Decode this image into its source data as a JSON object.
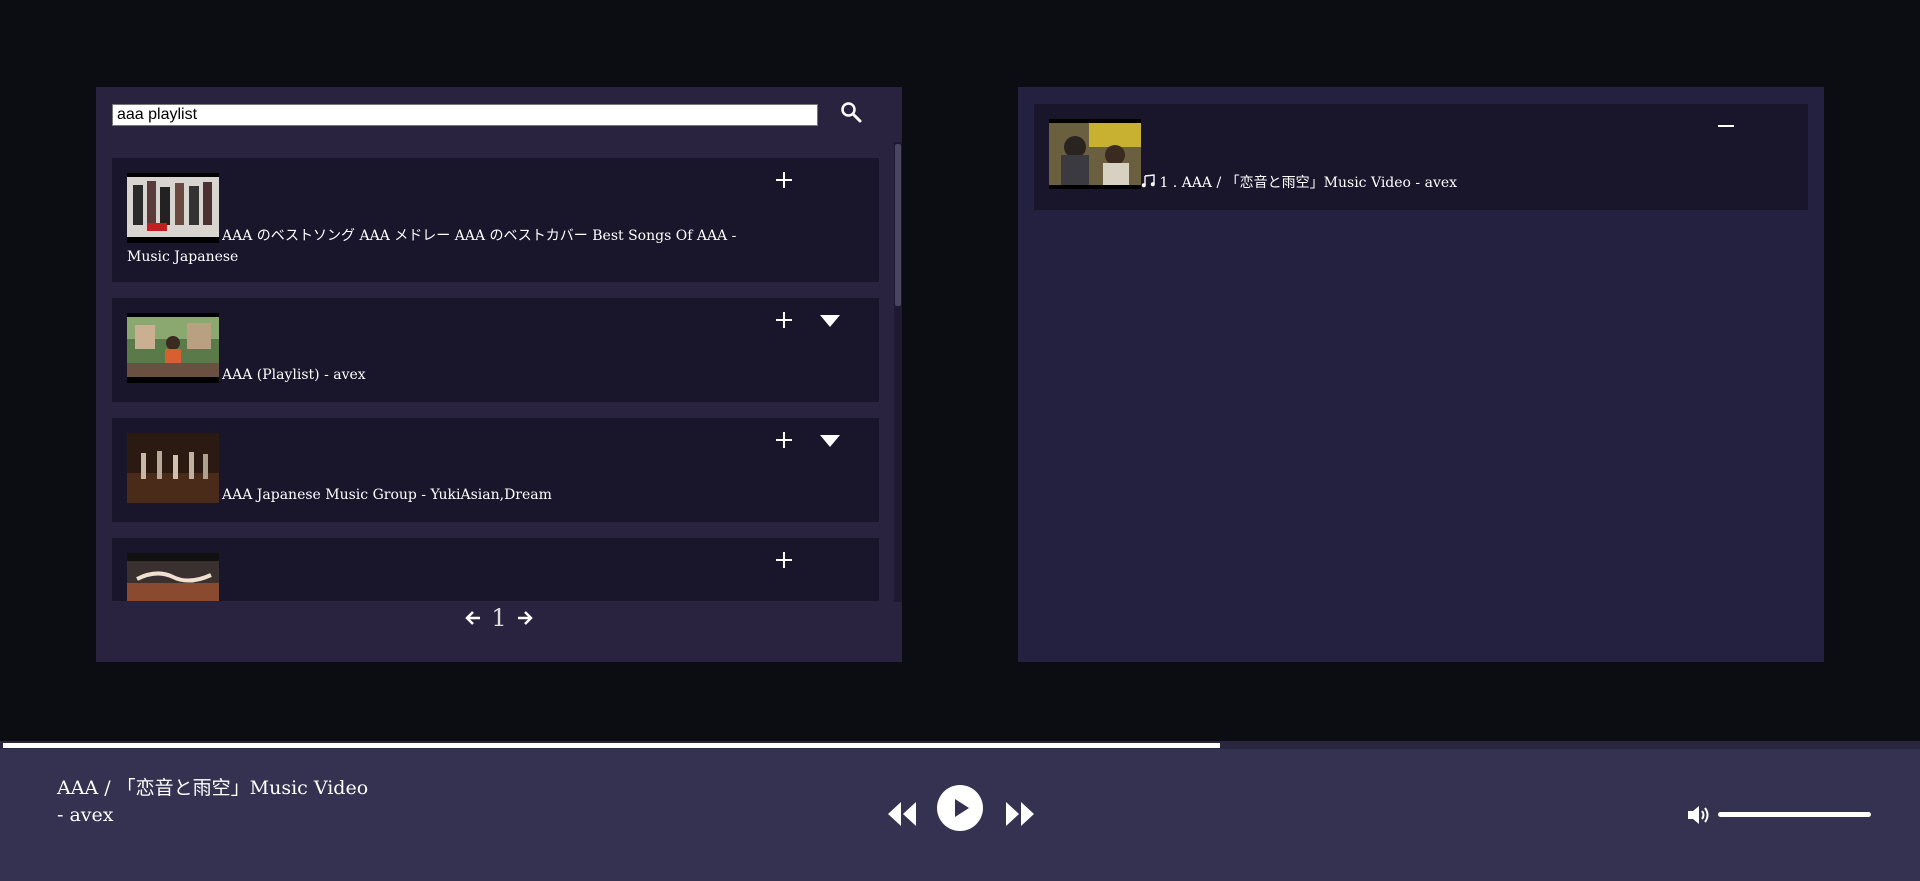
{
  "search": {
    "query": "aaa playlist",
    "icon": "search-icon"
  },
  "results": [
    {
      "title": "AAA のベストソング AAA メドレー AAA のベストカバー Best Songs Of AAA - Music Japanese",
      "has_expand": false
    },
    {
      "title": "AAA (Playlist) - avex",
      "has_expand": true
    },
    {
      "title": "AAA Japanese Music Group - YukiAsian,Dream",
      "has_expand": true
    },
    {
      "title": "",
      "has_expand": false
    }
  ],
  "pagination": {
    "current_page": "1"
  },
  "queue": [
    {
      "title": "1 . AAA / 「恋音と雨空」Music Video - avex",
      "icon": "music-note-icon"
    }
  ],
  "player": {
    "now_playing": "AAA / 「恋音と雨空」Music Video - avex",
    "progress_fraction": 0.635,
    "volume_fraction": 1.0
  },
  "colors": {
    "background": "#0c0c13",
    "panel": "#29233f",
    "card": "#19152a",
    "player_bar": "#353151"
  }
}
